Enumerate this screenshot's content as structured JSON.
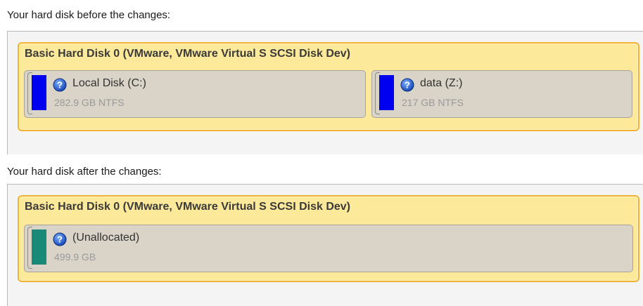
{
  "before": {
    "label": "Your hard disk before the changes:",
    "disk": {
      "title": "Basic Hard Disk 0 (VMware, VMware Virtual S SCSI Disk Dev)",
      "partitions": [
        {
          "name": "Local Disk (C:)",
          "size": "282.9 GB NTFS",
          "color": "#0000f0",
          "icon": "help-icon"
        },
        {
          "name": "data (Z:)",
          "size": "217 GB NTFS",
          "color": "#0000f0",
          "icon": "help-icon"
        }
      ]
    }
  },
  "after": {
    "label": "Your hard disk after the changes:",
    "disk": {
      "title": "Basic Hard Disk 0 (VMware, VMware Virtual S SCSI Disk Dev)",
      "partitions": [
        {
          "name": "(Unallocated)",
          "size": "499.9 GB",
          "color": "#1a8a78",
          "icon": "help-icon"
        }
      ]
    }
  }
}
